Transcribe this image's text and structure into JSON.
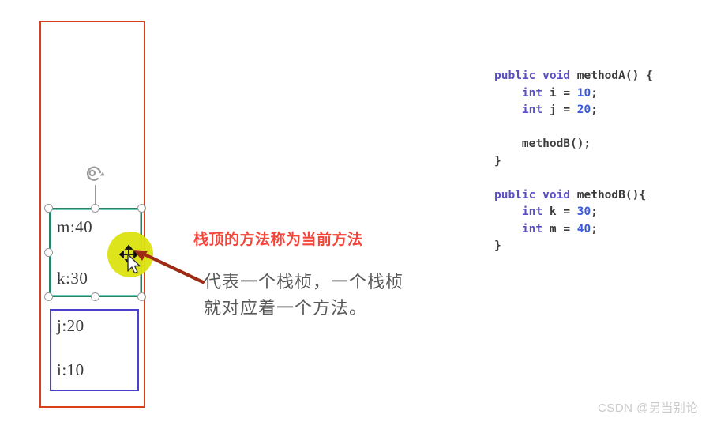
{
  "diagram": {
    "outer_box_name": "jvm-stack-outline",
    "outer_box_color": "#d8401c",
    "selected_frame": {
      "border_color": "#2e8065",
      "label": "selected-stack-frame",
      "variables": [
        {
          "text": "m:40"
        },
        {
          "text": "k:30"
        }
      ]
    },
    "lower_frame": {
      "border_color": "#4b3fcf",
      "label": "lower-stack-frame",
      "variables": [
        {
          "text": "j:20"
        },
        {
          "text": "i:10"
        }
      ]
    },
    "highlight_color": "#dce30f",
    "arrow_color": "#9e2c14"
  },
  "annotations": {
    "red_note": "栈顶的方法称为当前方法",
    "red_note_color": "#f4453a",
    "gray_note_line1": "代表一个栈桢，一个栈桢",
    "gray_note_line2": "就对应着一个方法。",
    "gray_note_color": "#595959"
  },
  "code": {
    "keyword_color": "#5b4fc6",
    "number_color": "#3b5bdb",
    "text_color": "#3c3c3c",
    "lines": [
      {
        "id": "l1",
        "parts": [
          {
            "t": "public void ",
            "c": "kw"
          },
          {
            "t": "methodA() {",
            "c": "plain"
          }
        ]
      },
      {
        "id": "l2",
        "parts": [
          {
            "t": "    ",
            "c": "plain"
          },
          {
            "t": "int",
            "c": "kw"
          },
          {
            "t": " i = ",
            "c": "plain"
          },
          {
            "t": "10",
            "c": "num"
          },
          {
            "t": ";",
            "c": "plain"
          }
        ]
      },
      {
        "id": "l3",
        "parts": [
          {
            "t": "    ",
            "c": "plain"
          },
          {
            "t": "int",
            "c": "kw"
          },
          {
            "t": " j = ",
            "c": "plain"
          },
          {
            "t": "20",
            "c": "num"
          },
          {
            "t": ";",
            "c": "plain"
          }
        ]
      },
      {
        "id": "l4",
        "parts": [
          {
            "t": " ",
            "c": "plain"
          }
        ]
      },
      {
        "id": "l5",
        "parts": [
          {
            "t": "    methodB();",
            "c": "plain"
          }
        ]
      },
      {
        "id": "l6",
        "parts": [
          {
            "t": "}",
            "c": "plain"
          }
        ]
      },
      {
        "id": "l7",
        "parts": [
          {
            "t": " ",
            "c": "plain"
          }
        ]
      },
      {
        "id": "l8",
        "parts": [
          {
            "t": "public void ",
            "c": "kw"
          },
          {
            "t": "methodB(){",
            "c": "plain"
          }
        ]
      },
      {
        "id": "l9",
        "parts": [
          {
            "t": "    ",
            "c": "plain"
          },
          {
            "t": "int",
            "c": "kw"
          },
          {
            "t": " k = ",
            "c": "plain"
          },
          {
            "t": "30",
            "c": "num"
          },
          {
            "t": ";",
            "c": "plain"
          }
        ]
      },
      {
        "id": "l10",
        "parts": [
          {
            "t": "    ",
            "c": "plain"
          },
          {
            "t": "int",
            "c": "kw"
          },
          {
            "t": " m = ",
            "c": "plain"
          },
          {
            "t": "40",
            "c": "num"
          },
          {
            "t": ";",
            "c": "plain"
          }
        ]
      },
      {
        "id": "l11",
        "parts": [
          {
            "t": "}",
            "c": "plain"
          }
        ]
      }
    ]
  },
  "watermark": {
    "text": "CSDN @另当别论"
  }
}
